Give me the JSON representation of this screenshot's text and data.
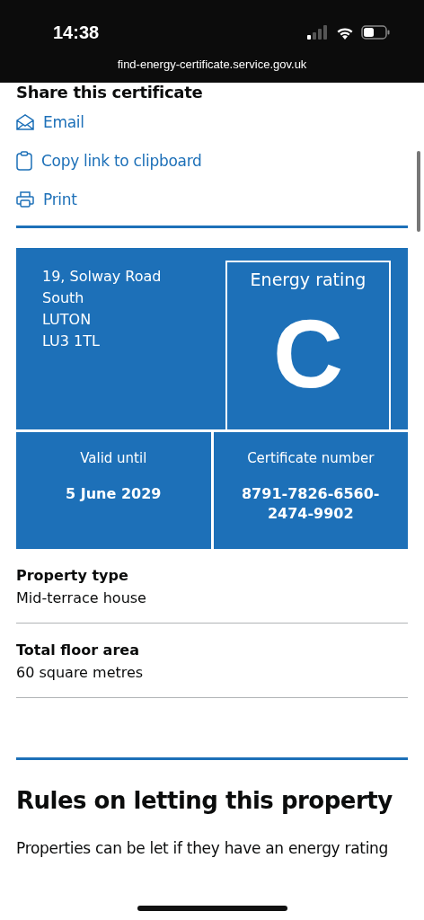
{
  "status_bar": {
    "time": "14:38",
    "url": "find-energy-certificate.service.gov.uk"
  },
  "share": {
    "title": "Share this certificate",
    "links": [
      {
        "kind": "email",
        "label": "Email"
      },
      {
        "kind": "copy",
        "label": "Copy link to clipboard"
      },
      {
        "kind": "print",
        "label": "Print"
      }
    ]
  },
  "certificate": {
    "address": [
      "19, Solway Road",
      "South",
      "LUTON",
      "LU3 1TL"
    ],
    "rating_label": "Energy rating",
    "rating": "C",
    "valid_label": "Valid until",
    "valid_date": "5 June 2029",
    "number_label": "Certificate number",
    "number": "8791-7826-6560-2474-9902"
  },
  "summary": [
    {
      "label": "Property type",
      "value": "Mid-terrace house"
    },
    {
      "label": "Total floor area",
      "value": "60 square metres"
    }
  ],
  "rules": {
    "title": "Rules on letting this property",
    "text": "Properties can be let if they have an energy rating"
  }
}
